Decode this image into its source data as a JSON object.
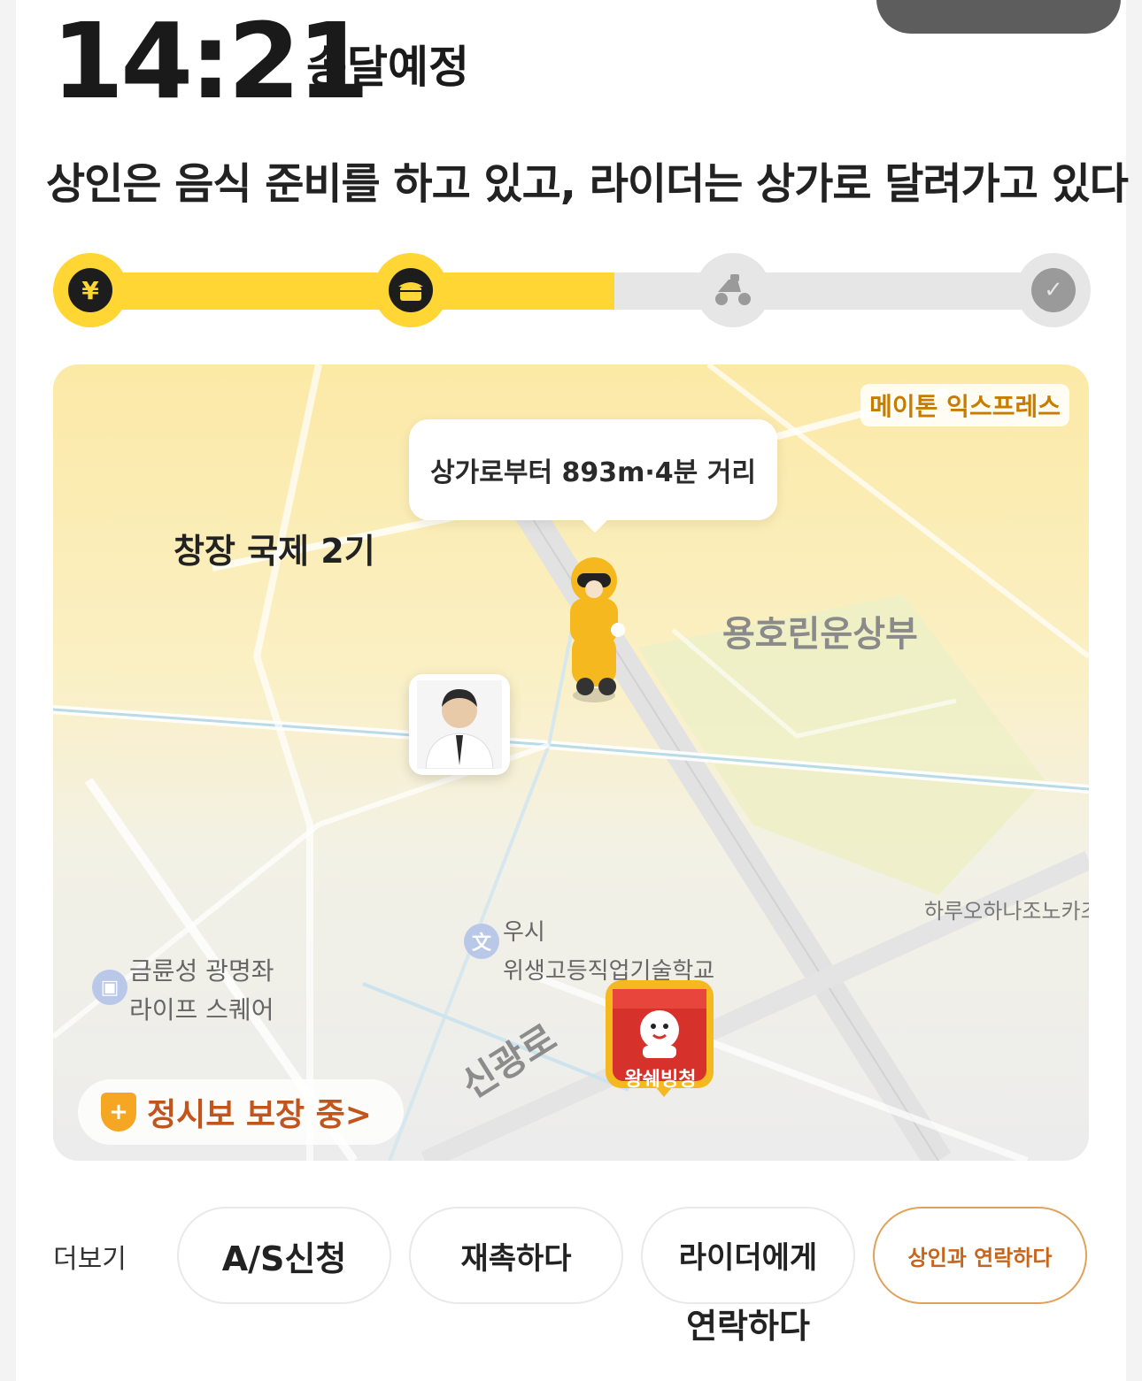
{
  "header": {
    "eta_time": "14:21",
    "eta_label": "송달예정",
    "status_text": "상인은 음식 준비를 하고 있고, 라이더는 상가로 달려가고 있다"
  },
  "progress": {
    "steps": [
      "payment",
      "merchant-preparing",
      "rider-delivering",
      "delivered"
    ],
    "completed_steps": 2,
    "fill_fraction": 0.545,
    "colors": {
      "done": "#ffd633",
      "todo": "#e6e6e6"
    }
  },
  "map": {
    "brand_tag": "메이톤 익스프레스",
    "distance_bubble": "상가로부터 893m·4분 거리",
    "labels": {
      "complex": "창장 국제 2기",
      "yongho": "용호린운상부",
      "haru": "하루오하나조노카즈",
      "school_1": "우시",
      "school_2": "위생고등직업기술학교",
      "mall_1": "금륜성 광명좌",
      "mall_2": "라이프 스퀘어",
      "road": "신광로",
      "shop_name": "왕쉐빙청"
    },
    "guarantee": "정시보 보장 중>"
  },
  "actions": {
    "more_label": "더보기",
    "as_request": "A/S신청",
    "remind": "재촉하다",
    "contact_rider_1": "라이더에게",
    "contact_rider_2": "연락하다",
    "contact_merchant": "상인과 연락하다"
  }
}
